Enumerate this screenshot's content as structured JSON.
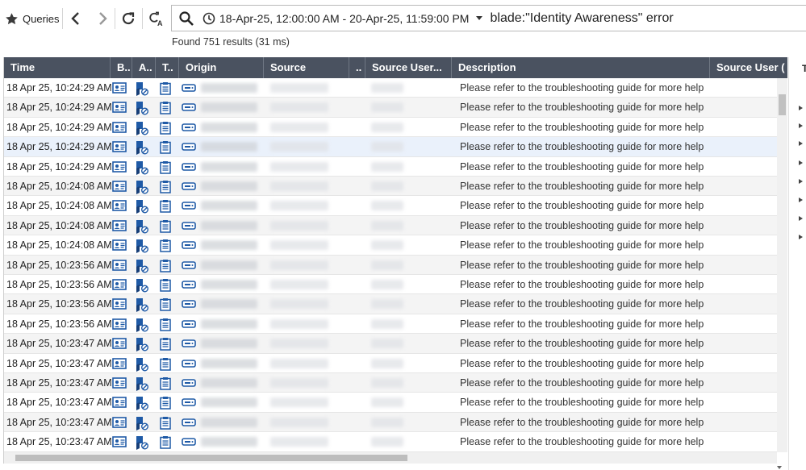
{
  "toolbar": {
    "queries_label": "Queries",
    "date_range": "18-Apr-25, 12:00:00 AM - 20-Apr-25, 11:59:00 PM",
    "query": "blade:\"Identity Awareness\" error"
  },
  "results_text": "Found 751 results (31 ms)",
  "columns": {
    "time": "Time",
    "blade": "B..",
    "action": "A..",
    "type": "T..",
    "origin": "Origin",
    "source": "Source",
    "dots": "..",
    "source_user_name": "Source User...",
    "description": "Description",
    "source_user": "Source User ("
  },
  "right_panel": {
    "title": "T"
  },
  "rows": [
    {
      "time": "18 Apr 25, 10:24:29 AM",
      "description": "Please refer to the troubleshooting guide for more help"
    },
    {
      "time": "18 Apr 25, 10:24:29 AM",
      "description": "Please refer to the troubleshooting guide for more help"
    },
    {
      "time": "18 Apr 25, 10:24:29 AM",
      "description": "Please refer to the troubleshooting guide for more help"
    },
    {
      "time": "18 Apr 25, 10:24:29 AM",
      "description": "Please refer to the troubleshooting guide for more help"
    },
    {
      "time": "18 Apr 25, 10:24:29 AM",
      "description": "Please refer to the troubleshooting guide for more help"
    },
    {
      "time": "18 Apr 25, 10:24:08 AM",
      "description": "Please refer to the troubleshooting guide for more help"
    },
    {
      "time": "18 Apr 25, 10:24:08 AM",
      "description": "Please refer to the troubleshooting guide for more help"
    },
    {
      "time": "18 Apr 25, 10:24:08 AM",
      "description": "Please refer to the troubleshooting guide for more help"
    },
    {
      "time": "18 Apr 25, 10:24:08 AM",
      "description": "Please refer to the troubleshooting guide for more help"
    },
    {
      "time": "18 Apr 25, 10:23:56 AM",
      "description": "Please refer to the troubleshooting guide for more help"
    },
    {
      "time": "18 Apr 25, 10:23:56 AM",
      "description": "Please refer to the troubleshooting guide for more help"
    },
    {
      "time": "18 Apr 25, 10:23:56 AM",
      "description": "Please refer to the troubleshooting guide for more help"
    },
    {
      "time": "18 Apr 25, 10:23:56 AM",
      "description": "Please refer to the troubleshooting guide for more help"
    },
    {
      "time": "18 Apr 25, 10:23:47 AM",
      "description": "Please refer to the troubleshooting guide for more help"
    },
    {
      "time": "18 Apr 25, 10:23:47 AM",
      "description": "Please refer to the troubleshooting guide for more help"
    },
    {
      "time": "18 Apr 25, 10:23:47 AM",
      "description": "Please refer to the troubleshooting guide for more help"
    },
    {
      "time": "18 Apr 25, 10:23:47 AM",
      "description": "Please refer to the troubleshooting guide for more help"
    },
    {
      "time": "18 Apr 25, 10:23:47 AM",
      "description": "Please refer to the troubleshooting guide for more help"
    },
    {
      "time": "18 Apr 25, 10:23:47 AM",
      "description": "Please refer to the troubleshooting guide for more help"
    }
  ],
  "icons": {
    "queries": "star-icon",
    "back": "chevron-left-icon",
    "forward": "chevron-right-icon",
    "refresh": "refresh-icon",
    "query_language": "query-language-icon",
    "search": "search-icon",
    "time_range": "clock-icon",
    "blade": "identity-card-icon",
    "action": "blocked-user-icon",
    "type": "log-clipboard-icon",
    "origin": "gateway-icon"
  },
  "colors": {
    "header_bg": "#4a5260",
    "selected_row": "#eaf1fb",
    "alt_row": "#f4f4f4",
    "icon_blue": "#1f5aa6"
  }
}
